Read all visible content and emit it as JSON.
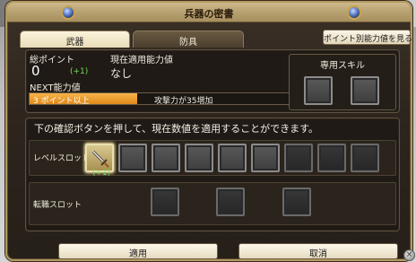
{
  "window": {
    "title": "兵器の密書"
  },
  "tabs": [
    {
      "label": "武器",
      "active": true
    },
    {
      "label": "防具",
      "active": false
    }
  ],
  "points_button": {
    "label": "ポイント別能力値を見る"
  },
  "stats": {
    "total_points_label": "総ポイント",
    "total_points_value": "0",
    "total_points_bonus": "(+1)",
    "current_ability_label": "現在適用能力値",
    "current_ability_value": "なし",
    "next_label": "NEXT能力値",
    "next_condition": "3 ポイント以上",
    "next_effect": "攻撃力が35増加",
    "next_progress": 0.4
  },
  "skill": {
    "title": "専用スキル"
  },
  "instruction": "下の確認ボタンを押して、現在数値を適用することができます。",
  "level_slots": {
    "label": "レベルスロット",
    "bonus": "(+1)",
    "icons": [
      "sword-icon"
    ]
  },
  "job_slots": {
    "label": "転職スロット"
  },
  "buttons": {
    "apply": "適用",
    "cancel": "取消"
  },
  "colors": {
    "accent": "#e08a1a",
    "bonus_green": "#6fdc5a",
    "frame": "#b29a62"
  }
}
